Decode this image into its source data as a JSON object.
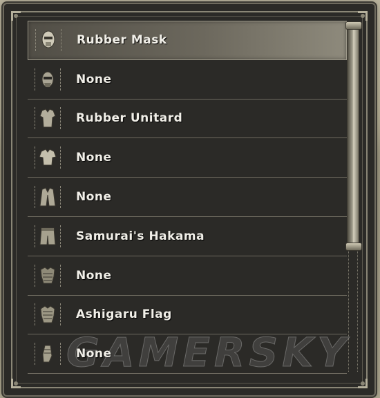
{
  "equipment_list": {
    "items": [
      {
        "label": "Rubber Mask",
        "icon": "head-mask-icon",
        "selected": true
      },
      {
        "label": "None",
        "icon": "face-mask-icon",
        "selected": false
      },
      {
        "label": "Rubber Unitard",
        "icon": "unitard-icon",
        "selected": false
      },
      {
        "label": "None",
        "icon": "shirt-icon",
        "selected": false
      },
      {
        "label": "None",
        "icon": "coat-icon",
        "selected": false
      },
      {
        "label": "Samurai's Hakama",
        "icon": "hakama-icon",
        "selected": false
      },
      {
        "label": "None",
        "icon": "armor-icon",
        "selected": false
      },
      {
        "label": "Ashigaru Flag",
        "icon": "flag-armor-icon",
        "selected": false
      },
      {
        "label": "None",
        "icon": "gauntlet-icon",
        "selected": false
      }
    ]
  },
  "watermark": {
    "text": "GAMERSKY"
  },
  "colors": {
    "panel": "#2b2a27",
    "frame": "#8a8676",
    "text": "#f1efe8"
  }
}
